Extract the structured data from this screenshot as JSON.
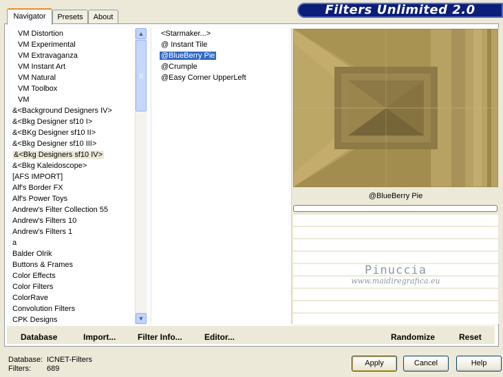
{
  "app": {
    "title": "Filters Unlimited 2.0"
  },
  "tabs": [
    {
      "label": "Navigator"
    },
    {
      "label": "Presets"
    },
    {
      "label": "About"
    }
  ],
  "categories": [
    "VM Distortion",
    "VM Experimental",
    "VM Extravaganza",
    "VM Instant Art",
    "VM Natural",
    "VM Toolbox",
    "VM",
    "&<Background Designers IV>",
    "&<Bkg Designer sf10 I>",
    "&<BKg Designer sf10 II>",
    "&<Bkg Designer sf10 III>",
    "&<Bkg Designers sf10 IV>",
    "&<Bkg Kaleidoscope>",
    "[AFS IMPORT]",
    "Alf's Border FX",
    "Alf's Power Toys",
    "Andrew's Filter Collection 55",
    "Andrew's Filters 10",
    "Andrew's Filters 1",
    "a",
    "Balder Olrik",
    "Buttons & Frames",
    "Color Effects",
    "Color Filters",
    "ColorRave",
    "Convolution Filters",
    "CPK Designs"
  ],
  "selected_category": "&<Bkg Designers sf10 IV>",
  "filters": [
    "<Starmaker...>",
    "@ Instant Tile",
    "@BlueBerry Pie",
    "@Crumple",
    "@Easy Corner UpperLeft"
  ],
  "selected_filter": "@BlueBerry Pie",
  "preview": {
    "current_filter": "@BlueBerry Pie",
    "watermark_name": "Pinuccia",
    "watermark_site": "www.maidiregrafica.eu"
  },
  "toolbar": {
    "database": "Database",
    "import": "Import...",
    "filter_info": "Filter Info...",
    "editor": "Editor...",
    "randomize": "Randomize",
    "reset": "Reset"
  },
  "footer": {
    "database_label": "Database:",
    "database_value": "ICNET-Filters",
    "filters_label": "Filters:",
    "filters_value": "689"
  },
  "buttons": {
    "apply": "Apply",
    "cancel": "Cancel",
    "help": "Help"
  },
  "colors": {
    "selection": "#316ac5",
    "banner": "#0a1e7a",
    "preview_base": "#a08a4e"
  }
}
